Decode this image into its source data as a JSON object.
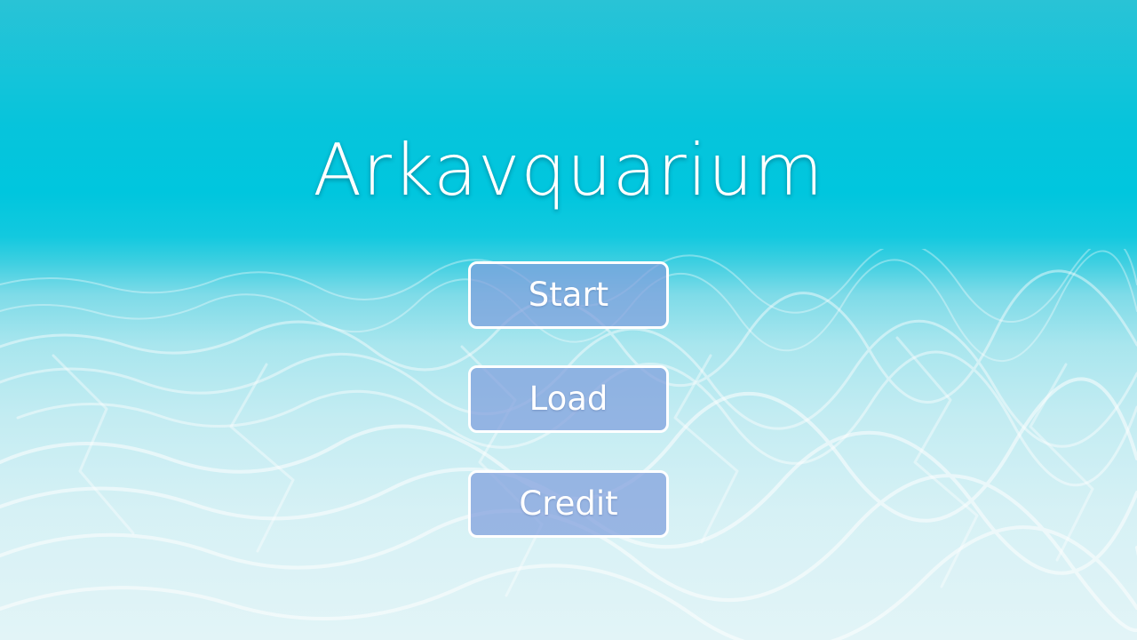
{
  "game": {
    "title": "Arkavquarium"
  },
  "menu": {
    "start_label": "Start",
    "load_label": "Load",
    "credit_label": "Credit"
  },
  "colors": {
    "water_top": "#00c6de",
    "sand_light": "#e2f4f7",
    "button_fill": "#809edc",
    "button_border": "#ffffff",
    "text": "#ffffff"
  }
}
